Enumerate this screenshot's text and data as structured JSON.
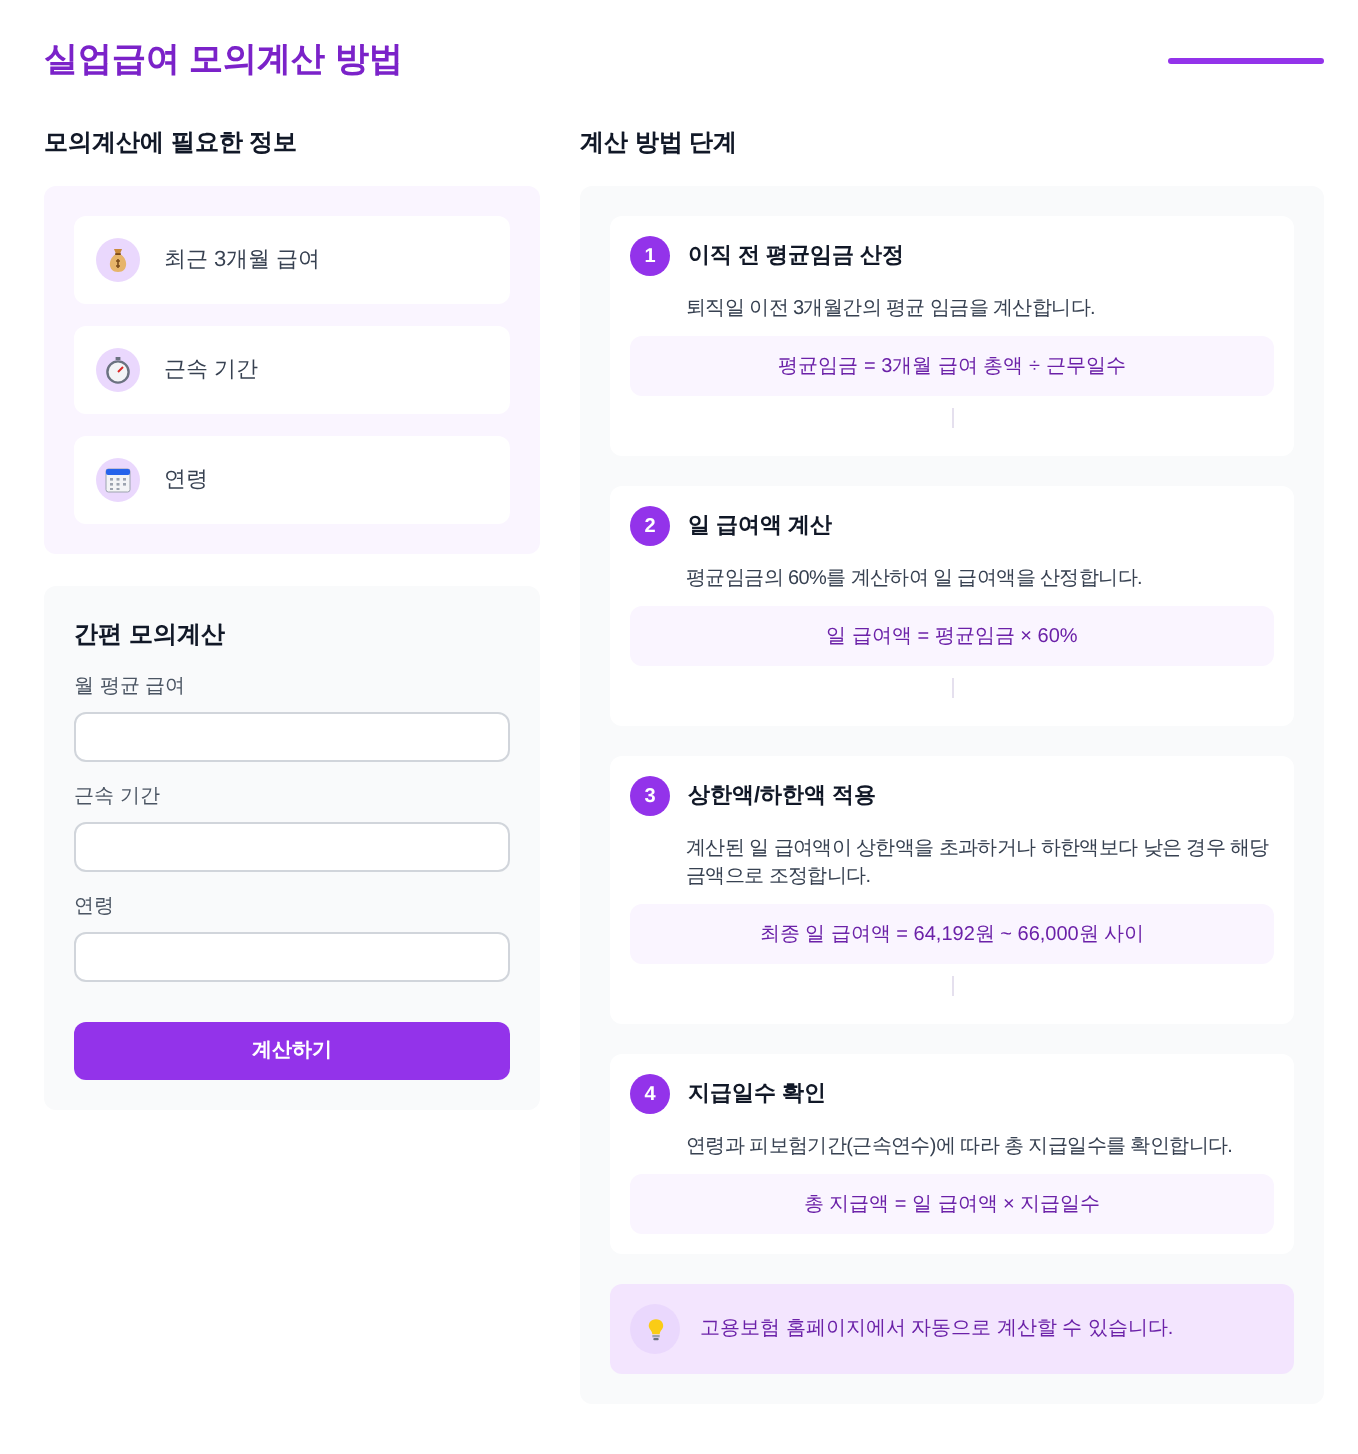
{
  "title": "실업급여 모의계산 방법",
  "info_section": {
    "heading": "모의계산에 필요한 정보",
    "items": [
      {
        "label": "최근 3개월 급여"
      },
      {
        "label": "근속 기간"
      },
      {
        "label": "연령"
      }
    ]
  },
  "calculator": {
    "title": "간편 모의계산",
    "fields": [
      {
        "label": "월 평균 급여"
      },
      {
        "label": "근속 기간"
      },
      {
        "label": "연령"
      }
    ],
    "button": "계산하기"
  },
  "steps_section": {
    "heading": "계산 방법 단계",
    "steps": [
      {
        "number": "1",
        "title": "이직 전 평균임금 산정",
        "description": "퇴직일 이전 3개월간의 평균 임금을 계산합니다.",
        "formula": "평균임금 = 3개월 급여 총액 ÷ 근무일수"
      },
      {
        "number": "2",
        "title": "일 급여액 계산",
        "description": "평균임금의 60%를 계산하여 일 급여액을 산정합니다.",
        "formula": "일 급여액 = 평균임금 × 60%"
      },
      {
        "number": "3",
        "title": "상한액/하한액 적용",
        "description": "계산된 일 급여액이 상한액을 초과하거나 하한액보다 낮은 경우 해당 금액으로 조정합니다.",
        "formula": "최종 일 급여액 = 64,192원 ~ 66,000원 사이"
      },
      {
        "number": "4",
        "title": "지급일수 확인",
        "description": "연령과 피보험기간(근속연수)에 따라 총 지급일수를 확인합니다.",
        "formula": "총 지급액 = 일 급여액 × 지급일수"
      }
    ],
    "tip": "고용보험 홈페이지에서 자동으로 계산할 수 있습니다."
  }
}
